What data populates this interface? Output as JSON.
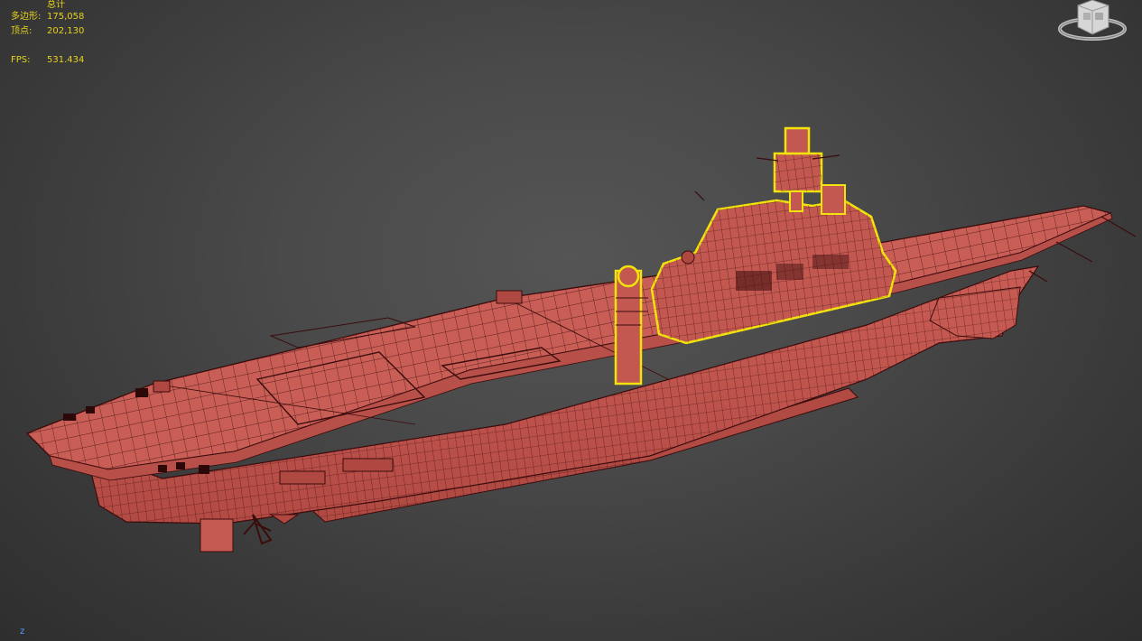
{
  "viewport": {
    "stats": {
      "header": "总计",
      "polygons_label": "多边形:",
      "polygons_value": "175,058",
      "vertices_label": "顶点:",
      "vertices_value": "202,130",
      "fps_label": "FPS:",
      "fps_value": "531.434"
    },
    "axis_label": "z",
    "colors": {
      "background": "#444444",
      "mesh_fill": "#c55a52",
      "wire": "#3a0c0c",
      "selection": "#f2e30c",
      "stats_text": "#e6d21e"
    },
    "icons": [
      "viewcube-icon",
      "axis-tripod-icon"
    ]
  }
}
